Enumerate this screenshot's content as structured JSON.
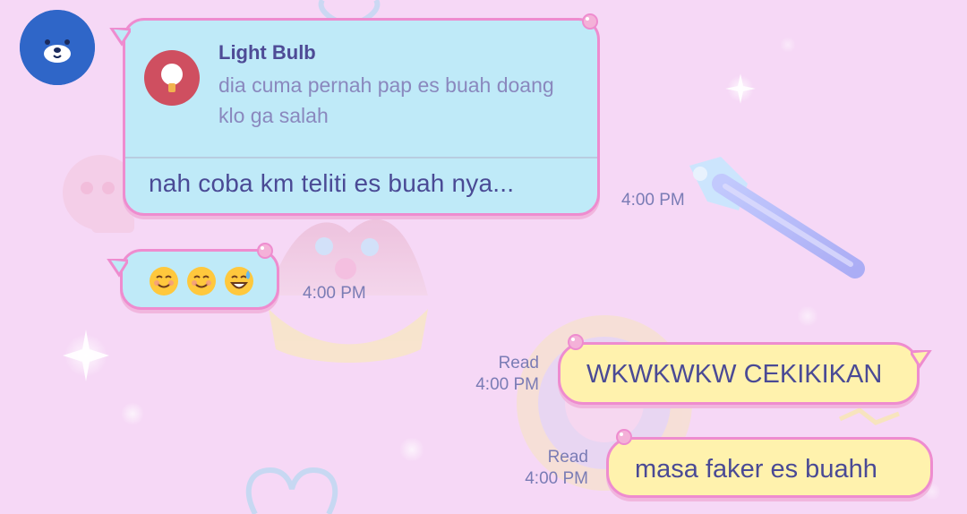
{
  "chat": {
    "contact_avatar": {
      "icon": "bear-icon",
      "color": "#2f66c8"
    },
    "messages": [
      {
        "type": "incoming_reply",
        "reply_preview": {
          "title": "Light Bulb",
          "text": "dia cuma pernah pap es buah doang klo ga salah",
          "icon": "lightbulb-icon",
          "icon_color": "#cf4f60"
        },
        "text": "nah coba km teliti es buah nya...",
        "time": "4:00 PM"
      },
      {
        "type": "incoming_emoji",
        "emojis": [
          "☺️",
          "☺️",
          "😅"
        ],
        "time": "4:00 PM"
      },
      {
        "type": "outgoing",
        "text": "WKWKWKW CEKIKIKAN",
        "status": "Read",
        "time": "4:00 PM"
      },
      {
        "type": "outgoing",
        "text": "masa faker es buahh",
        "status": "Read",
        "time": "4:00 PM"
      }
    ]
  },
  "theme": {
    "background": "#f6d8f6",
    "incoming_bubble": "#bfeaf8",
    "outgoing_bubble": "#fff2ad",
    "bubble_border": "#ee8ccf",
    "text": "#4a4a95",
    "meta_text": "#7a7cb5"
  }
}
